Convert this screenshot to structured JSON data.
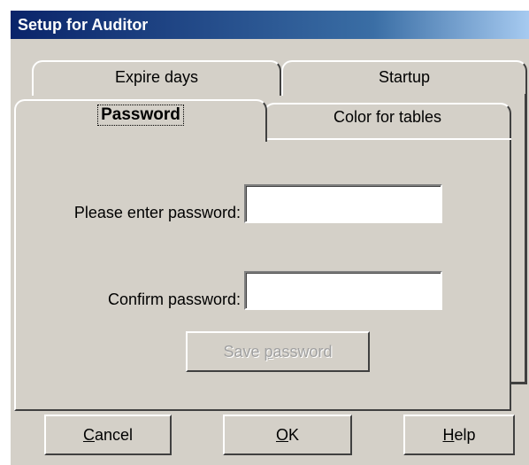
{
  "window": {
    "title": "Setup for Auditor"
  },
  "tabs": {
    "back_row": [
      {
        "label": "Expire days"
      },
      {
        "label": "Startup"
      }
    ],
    "front_row": [
      {
        "label": "Password",
        "selected": true
      },
      {
        "label": "Color for tables",
        "selected": false
      }
    ]
  },
  "password_panel": {
    "password_label": "Please enter password:",
    "password_value": "",
    "confirm_label": "Confirm password:",
    "confirm_value": "",
    "save_button": {
      "pre": "Save ",
      "accel": "p",
      "post": "assword",
      "enabled": false
    }
  },
  "footer_buttons": {
    "cancel": {
      "accel": "C",
      "rest": "ancel"
    },
    "ok": {
      "accel": "O",
      "rest": "K"
    },
    "help": {
      "accel": "H",
      "rest": "elp"
    }
  }
}
